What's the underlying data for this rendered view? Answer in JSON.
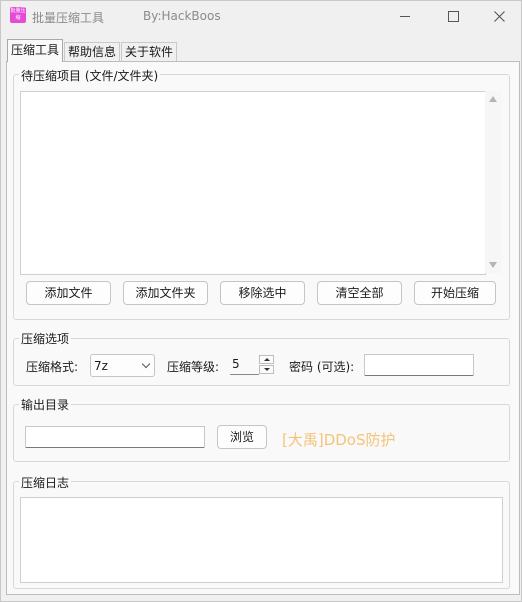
{
  "window": {
    "app_icon_text": "批量压缩",
    "title": "批量压缩工具",
    "author": "By:HackBoos"
  },
  "tabs": [
    {
      "label": "压缩工具",
      "active": true
    },
    {
      "label": "帮助信息",
      "active": false
    },
    {
      "label": "关于软件",
      "active": false
    }
  ],
  "items_group": {
    "title": "待压缩项目 (文件/文件夹)",
    "buttons": {
      "add_file": "添加文件",
      "add_folder": "添加文件夹",
      "remove_selected": "移除选中",
      "clear_all": "清空全部",
      "start": "开始压缩"
    }
  },
  "options_group": {
    "title": "压缩选项",
    "format_label": "压缩格式:",
    "format_value": "7z",
    "level_label": "压缩等级:",
    "level_value": "5",
    "password_label": "密码 (可选):",
    "password_value": ""
  },
  "output_group": {
    "title": "输出目录",
    "path_value": "",
    "browse_label": "浏览",
    "promo_text": "[大禹]DDoS防护"
  },
  "log_group": {
    "title": "压缩日志"
  },
  "colors": {
    "promo_text": "#f5c37a",
    "app_icon_bg": "#e64bd6"
  }
}
